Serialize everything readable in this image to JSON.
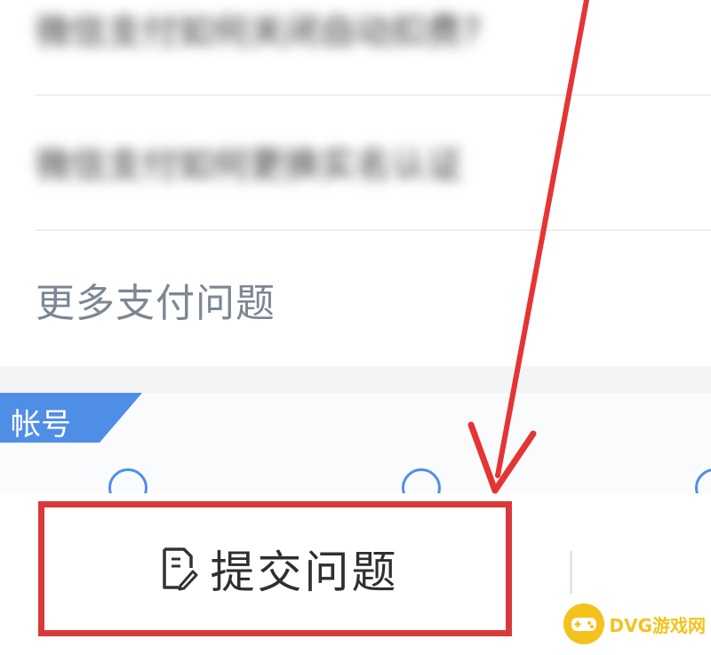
{
  "faq": {
    "items": [
      {
        "label": "微信支付如何关闭自动扣费?"
      },
      {
        "label": "微信支付如何更换实名认证"
      }
    ],
    "more_label": "更多支付问题"
  },
  "account": {
    "tag_label": "帐号"
  },
  "bottom_bar": {
    "submit_label": "提交问题"
  },
  "watermark": {
    "text": "DVG游戏网"
  },
  "colors": {
    "accent_blue": "#4f8ee7",
    "highlight_red": "#d9393b",
    "watermark_yellow": "#f4c21d"
  },
  "icons": {
    "submit": "edit-icon",
    "arrow": "red-arrow-annotation"
  }
}
